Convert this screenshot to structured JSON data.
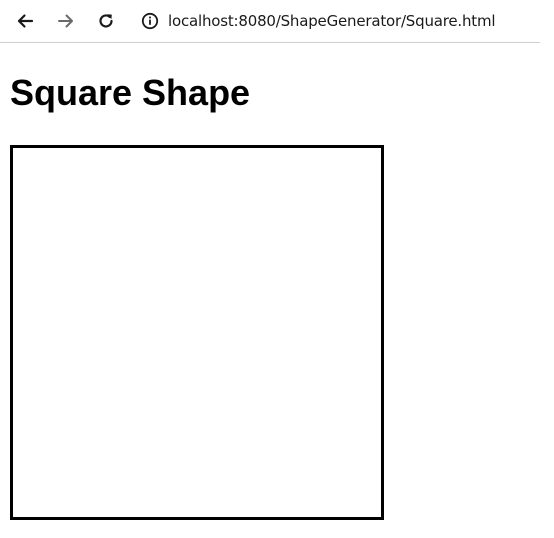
{
  "browser": {
    "url": "localhost:8080/ShapeGenerator/Square.html",
    "icons": {
      "back": "arrow-left-icon",
      "forward": "arrow-right-icon",
      "reload": "reload-icon",
      "info": "info-icon"
    }
  },
  "page": {
    "title": "Square Shape"
  },
  "colors": {
    "text": "#000000",
    "square_border": "#000000",
    "background": "#ffffff"
  }
}
